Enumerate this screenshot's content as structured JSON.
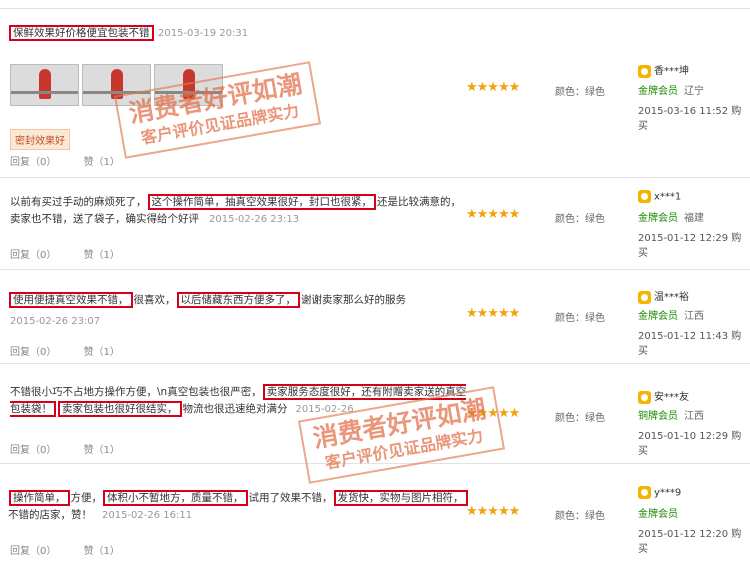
{
  "watermark": {
    "line1": "消费者好评如潮",
    "line2": "客户评价见证品牌实力"
  },
  "actions": {
    "reply": "回复（0）",
    "like": "赞（1）"
  },
  "reviews": [
    {
      "text_parts": [
        "保鲜效果好价格便宜包装不错"
      ],
      "highlighted": [
        true
      ],
      "date": "2015-03-19 20:31",
      "tag": "密封效果好",
      "rating": "★★★★★",
      "color_label": "颜色：绿色",
      "user": "香***坤",
      "level": "金牌会员",
      "province": "辽宁",
      "user_date": "2015-03-16 11:52 购买"
    },
    {
      "text_parts": [
        "以前有买过手动的麻烦死了，",
        "这个操作简单，抽真空效果很好，封口也很紧，",
        "还是比较满意的，卖家也不错，送了袋子，确实得给个好评"
      ],
      "highlighted": [
        false,
        true,
        false
      ],
      "date": "2015-02-26 23:13",
      "rating": "★★★★★",
      "color_label": "颜色：绿色",
      "user": "x***1",
      "level": "金牌会员",
      "province": "福建",
      "user_date": "2015-01-12 12:29 购买"
    },
    {
      "text_parts": [
        "使用便捷真空效果不错，",
        "很喜欢，",
        "以后储藏东西方便多了，",
        "谢谢卖家那么好的服务"
      ],
      "highlighted": [
        true,
        false,
        true,
        false
      ],
      "date": "2015-02-26 23:07",
      "rating": "★★★★★",
      "color_label": "颜色：绿色",
      "user": "温***裕",
      "level": "金牌会员",
      "province": "江西",
      "user_date": "2015-01-12 11:43 购买"
    },
    {
      "text_parts": [
        "不错很小巧不占地方操作方便，\\n真空包装也很严密，",
        "卖家服务态度很好，还有附赠卖家送的真空包装袋！",
        "卖家包装也很好很结实，",
        "物流也很迅速绝对满分"
      ],
      "highlighted": [
        false,
        true,
        true,
        false
      ],
      "date": "2015-02-26",
      "rating": "★★★★★",
      "color_label": "颜色：绿色",
      "user": "安***友",
      "level": "铜牌会员",
      "province": "江西",
      "user_date": "2015-01-10 12:29 购买"
    },
    {
      "text_parts": [
        "操作简单，",
        "方便，",
        "体积小不暂地方，质量不错，",
        "试用了效果不错，",
        "发货快，实物与图片相符，",
        "不错的店家，赞！"
      ],
      "highlighted": [
        true,
        false,
        true,
        false,
        true,
        false
      ],
      "date": "2015-02-26 16:11",
      "rating": "★★★★★",
      "color_label": "颜色：绿色",
      "user": "y***9",
      "level": "金牌会员",
      "province": "",
      "user_date": "2015-01-12 12:20 购买"
    }
  ]
}
